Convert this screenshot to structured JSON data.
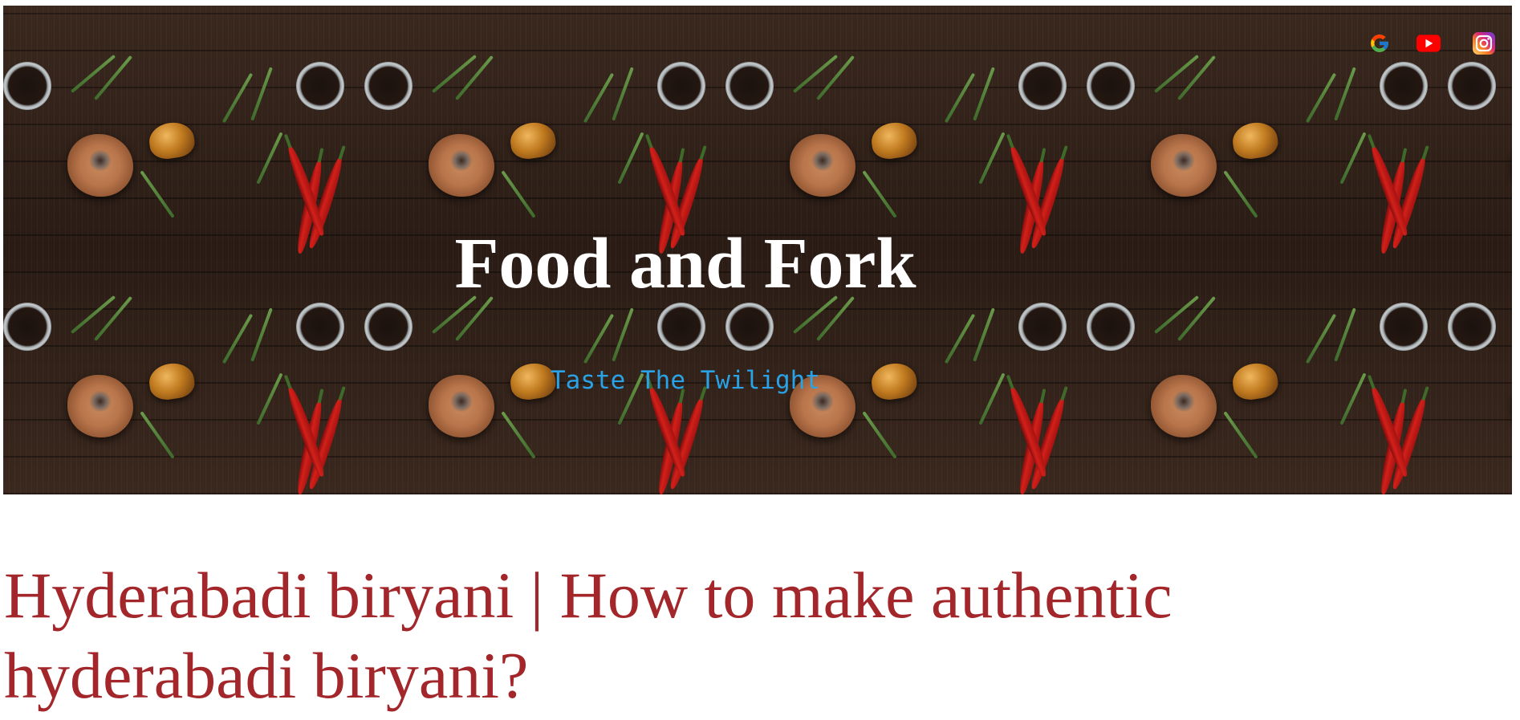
{
  "header": {
    "title": "Food and Fork",
    "tagline": "Taste The Twilight",
    "social_links": [
      {
        "name": "google-icon",
        "label": "Google"
      },
      {
        "name": "youtube-icon",
        "label": "YouTube"
      },
      {
        "name": "instagram-icon",
        "label": "Instagram"
      }
    ]
  },
  "post": {
    "title": "Hyderabadi biryani | How to make authentic hyderabadi biryani?"
  },
  "colors": {
    "title": "#ffffff",
    "tagline": "#29a3e6",
    "post_title": "#a2262a"
  }
}
